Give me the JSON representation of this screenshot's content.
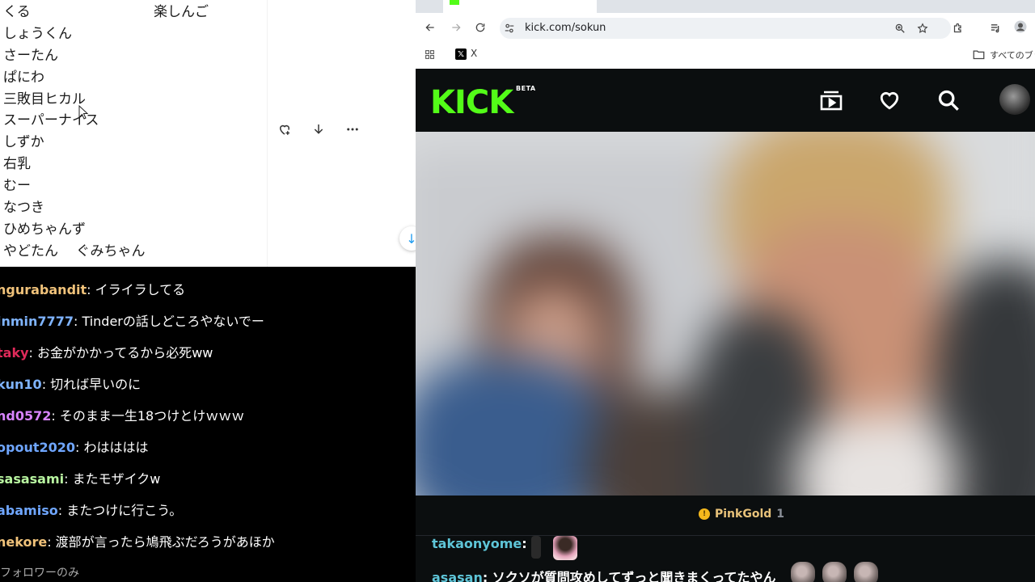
{
  "name_list": [
    {
      "name": "くる",
      "second": "楽しんご"
    },
    {
      "name": "しょうくん"
    },
    {
      "name": "さーたん"
    },
    {
      "name": "ぱにわ"
    },
    {
      "name": "三敗目ヒカル"
    },
    {
      "name": "スーパーナイス"
    },
    {
      "name": "しずか"
    },
    {
      "name": "右乳"
    },
    {
      "name": "むー"
    },
    {
      "name": "なつき"
    },
    {
      "name": "ひめちゃんず"
    },
    {
      "name": "やどたん",
      "second": "ぐみちゃん"
    }
  ],
  "left_chat": [
    {
      "user": "ngurabandit",
      "message": "イライラしてる",
      "color": "#f0c27a"
    },
    {
      "user": "inmin7777",
      "message": "Tinderの話しどころやないでー",
      "color": "#7fb4ff"
    },
    {
      "user": "taky",
      "message": "お金がかかってるから必死ww",
      "color": "#e02a5a"
    },
    {
      "user": "kun10",
      "message": "切れば早いのに",
      "color": "#7fb4ff"
    },
    {
      "user": "nd0572",
      "message": "そのまま一生18つけとけｗｗｗ",
      "color": "#d884ff"
    },
    {
      "user": "opout2020",
      "message": "わはははは",
      "color": "#6fa6ff"
    },
    {
      "user": "sasasami",
      "message": "またモザイクw",
      "color": "#b8f5a0"
    },
    {
      "user": "abamiso",
      "message": "またつけに行こう。",
      "color": "#6fa6ff"
    },
    {
      "user": "nekore",
      "message": "渡部が言ったら鳩飛ぶだろうがあほか",
      "color": "#f0c27a"
    }
  ],
  "follower_only": "フォロワーのみ",
  "browser": {
    "url": "kick.com/sokun",
    "bookmark_x": "X",
    "bookmark_folder": "すべてのブック"
  },
  "kick": {
    "logo": "KICK",
    "beta": "BETA",
    "pinkgold_label": "PinkGold",
    "pinkgold_count": "1",
    "coin_glyph": "!",
    "chat": [
      {
        "user": "takaonyome",
        "message": ""
      },
      {
        "user": "asasan",
        "message": "ソクソが質問攻めしてずっと聞きまくってたやん"
      }
    ]
  },
  "icons": {
    "back": "arrow-left-icon",
    "forward": "arrow-right-icon",
    "reload": "reload-icon",
    "site_info": "tune-icon",
    "zoom": "zoom-icon",
    "star": "star-icon",
    "extensions": "puzzle-icon",
    "media": "media-control-icon",
    "profile": "profile-icon",
    "apps": "apps-grid-icon",
    "vod": "vod-icon",
    "heart": "heart-icon",
    "search": "search-icon"
  }
}
